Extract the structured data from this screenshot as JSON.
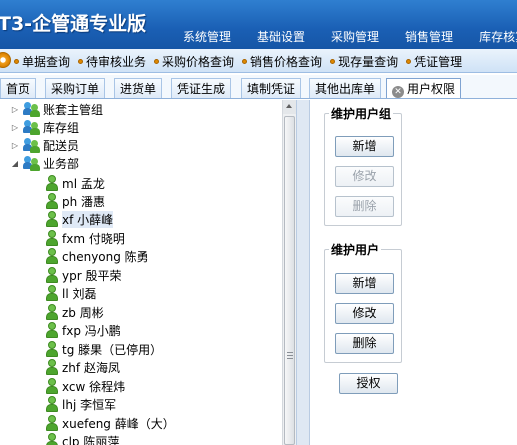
{
  "header": {
    "app_title": "T3-企管通专业版",
    "menu": [
      "系统管理",
      "基础设置",
      "采购管理",
      "销售管理",
      "库存核算"
    ]
  },
  "quickbar": {
    "items": [
      "单据查询",
      "待审核业务",
      "采购价格查询",
      "销售价格查询",
      "现存量查询",
      "凭证管理"
    ]
  },
  "tabs": [
    {
      "label": "首页"
    },
    {
      "label": "采购订单"
    },
    {
      "label": "进货单"
    },
    {
      "label": "凭证生成"
    },
    {
      "label": "填制凭证"
    },
    {
      "label": "其他出库单"
    },
    {
      "label": "用户权限",
      "active": true
    }
  ],
  "tree": {
    "groups": [
      {
        "label": "账套主管组",
        "expanded": false
      },
      {
        "label": "库存组",
        "expanded": false
      },
      {
        "label": "配送员",
        "expanded": false
      },
      {
        "label": "业务部",
        "expanded": true
      }
    ],
    "users": [
      "ml 孟龙",
      "ph 潘惠",
      "xf 小薛峰",
      "fxm 付晓明",
      "chenyong 陈勇",
      "ypr 殷平荣",
      "ll 刘磊",
      "zb 周彬",
      "fxp 冯小鹏",
      "tg 滕果（已停用）",
      "zhf 赵海凤",
      "xcw 徐程炜",
      "lhj 李恒军",
      "xuefeng 薛峰（大）",
      "clp 陈丽萍"
    ],
    "selected_user": "xf 小薛峰"
  },
  "user_group_box": {
    "title": "维护用户组",
    "add": "新增",
    "edit": "修改",
    "delete": "删除"
  },
  "user_box": {
    "title": "维护用户",
    "add": "新增",
    "edit": "修改",
    "delete": "删除"
  },
  "authorize_label": "授权"
}
